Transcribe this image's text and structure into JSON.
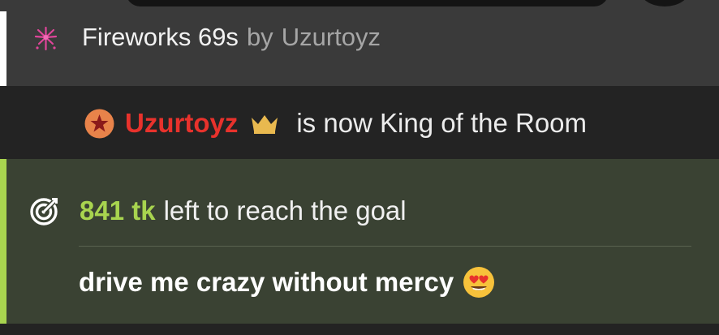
{
  "fireworks": {
    "icon": "fireworks-icon",
    "name": "Fireworks 69s",
    "by": "by",
    "user": "Uzurtoyz"
  },
  "king": {
    "badge_icon": "star-badge-icon",
    "user": "Uzurtoyz",
    "crown_icon": "crown-icon",
    "text": "is now King of the Room",
    "user_color": "#e8322c"
  },
  "goal": {
    "icon": "target-icon",
    "amount": "841 tk",
    "text": "left to reach the goal",
    "description": "drive me crazy without mercy",
    "emoji_icon": "heart-eyes-emoji-icon",
    "accent_color": "#a8d44f"
  }
}
